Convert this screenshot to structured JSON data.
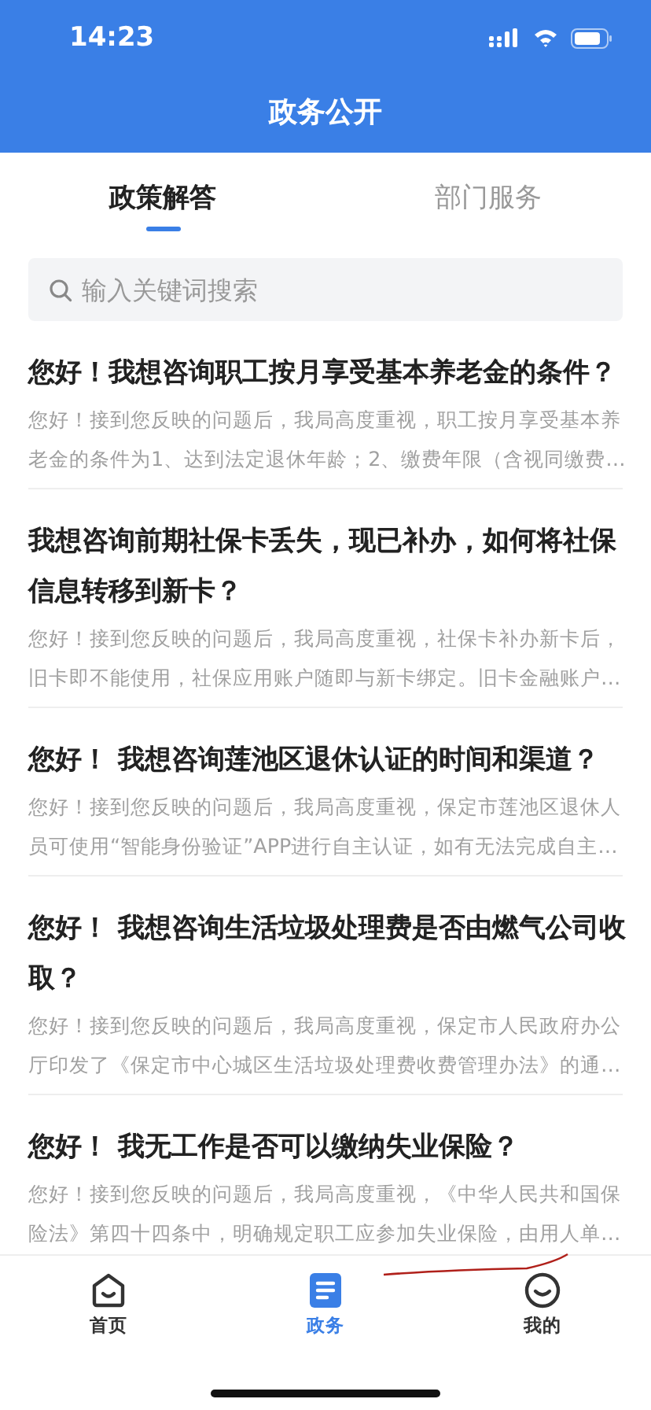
{
  "status_bar": {
    "time": "14:23"
  },
  "header": {
    "title": "政务公开"
  },
  "tabs": [
    {
      "label": "政策解答",
      "selected": true
    },
    {
      "label": "部门服务",
      "selected": false
    }
  ],
  "search": {
    "placeholder": "输入关键词搜索"
  },
  "articles": [
    {
      "title_lines": [
        "您好！我想咨询职工按月享受基本养老金的条件？"
      ],
      "snippet_lines": [
        "您好！接到您反映的问题后，我局高度重视，职工按月享受基本养",
        "老金的条件为1、达到法定退休年龄；2、缴费年限（含视同缴费…"
      ]
    },
    {
      "title_lines": [
        "我想咨询前期社保卡丢失，现已补办，如何将社保",
        "信息转移到新卡？"
      ],
      "snippet_lines": [
        "您好！接到您反映的问题后，我局高度重视，社保卡补办新卡后，",
        "旧卡即不能使用，社保应用账户随即与新卡绑定。旧卡金融账户…"
      ]
    },
    {
      "title_lines": [
        "您好！ 我想咨询莲池区退休认证的时间和渠道？"
      ],
      "snippet_lines": [
        "您好！接到您反映的问题后，我局高度重视，保定市莲池区退休人",
        "员可使用“智能身份验证”APP进行自主认证，如有无法完成自主…"
      ]
    },
    {
      "title_lines": [
        "您好！ 我想咨询生活垃圾处理费是否由燃气公司收",
        "取？"
      ],
      "snippet_lines": [
        "您好！接到您反映的问题后，我局高度重视，保定市人民政府办公",
        "厅印发了《保定市中心城区生活垃圾处理费收费管理办法》的通…"
      ]
    },
    {
      "title_lines": [
        "您好！ 我无工作是否可以缴纳失业保险？"
      ],
      "snippet_lines": [
        "您好！接到您反映的问题后，我局高度重视，《中华人民共和国保",
        "险法》第四十四条中，明确规定职工应参加失业保险，由用人单…"
      ]
    }
  ],
  "tab_bar": [
    {
      "kind": "home",
      "label": "首页",
      "selected": false
    },
    {
      "kind": "doc",
      "label": "政务",
      "selected": true
    },
    {
      "kind": "smile",
      "label": "我的",
      "selected": false
    }
  ]
}
